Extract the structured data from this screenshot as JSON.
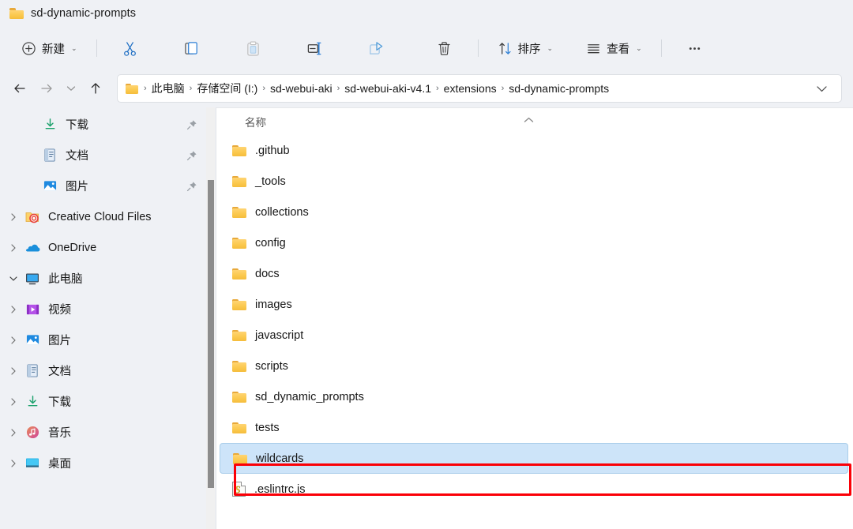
{
  "window": {
    "tab_title": "sd-dynamic-prompts",
    "tab_icon": "folder-icon"
  },
  "toolbar": {
    "new_label": "新建",
    "new_icon": "plus-circle-icon",
    "cut_icon": "scissors-icon",
    "copy_icon": "copy-icon",
    "paste_icon": "clipboard-paste-icon",
    "rename_icon": "rename-icon",
    "share_icon": "share-icon",
    "delete_icon": "trash-icon",
    "sort_label": "排序",
    "sort_icon": "sort-arrows-icon",
    "view_label": "查看",
    "view_icon": "list-lines-icon",
    "more_label": "•••",
    "more_icon": "ellipsis-icon"
  },
  "address": {
    "back_icon": "arrow-left-icon",
    "forward_icon": "arrow-right-icon",
    "recent_icon": "chevron-down-icon",
    "up_icon": "arrow-up-icon",
    "path_icon": "folder-icon",
    "crumbs": [
      "此电脑",
      "存储空间 (I:)",
      "sd-webui-aki",
      "sd-webui-aki-v4.1",
      "extensions",
      "sd-dynamic-prompts"
    ],
    "separator": "›",
    "dropdown_icon": "chevron-down-icon"
  },
  "sidebar": {
    "items": [
      {
        "label": "下载",
        "icon": "download-icon",
        "indent": 1,
        "expander": "none",
        "pinned": true
      },
      {
        "label": "文档",
        "icon": "document-icon",
        "indent": 1,
        "expander": "none",
        "pinned": true
      },
      {
        "label": "图片",
        "icon": "pictures-icon",
        "indent": 1,
        "expander": "none",
        "pinned": true
      },
      {
        "label": "Creative Cloud Files",
        "icon": "creative-cloud-icon",
        "indent": 0,
        "expander": "collapsed",
        "pinned": false
      },
      {
        "label": "OneDrive",
        "icon": "onedrive-icon",
        "indent": 0,
        "expander": "collapsed",
        "pinned": false
      },
      {
        "label": "此电脑",
        "icon": "this-pc-icon",
        "indent": 0,
        "expander": "expanded",
        "pinned": false
      },
      {
        "label": "视频",
        "icon": "videos-icon",
        "indent": 1,
        "expander": "collapsed",
        "pinned": false
      },
      {
        "label": "图片",
        "icon": "pictures-icon",
        "indent": 1,
        "expander": "collapsed",
        "pinned": false
      },
      {
        "label": "文档",
        "icon": "document-icon",
        "indent": 1,
        "expander": "collapsed",
        "pinned": false
      },
      {
        "label": "下载",
        "icon": "download-icon",
        "indent": 1,
        "expander": "collapsed",
        "pinned": false
      },
      {
        "label": "音乐",
        "icon": "music-icon",
        "indent": 1,
        "expander": "collapsed",
        "pinned": false
      },
      {
        "label": "桌面",
        "icon": "desktop-icon",
        "indent": 1,
        "expander": "collapsed",
        "pinned": false
      }
    ]
  },
  "filelist": {
    "column_header": "名称",
    "sort_indicator": "ascending",
    "rows": [
      {
        "name": ".github",
        "icon": "folder-icon",
        "selected": false
      },
      {
        "name": "_tools",
        "icon": "folder-icon",
        "selected": false
      },
      {
        "name": "collections",
        "icon": "folder-icon",
        "selected": false
      },
      {
        "name": "config",
        "icon": "folder-icon",
        "selected": false
      },
      {
        "name": "docs",
        "icon": "folder-icon",
        "selected": false
      },
      {
        "name": "images",
        "icon": "folder-icon",
        "selected": false
      },
      {
        "name": "javascript",
        "icon": "folder-icon",
        "selected": false
      },
      {
        "name": "scripts",
        "icon": "folder-icon",
        "selected": false
      },
      {
        "name": "sd_dynamic_prompts",
        "icon": "folder-icon",
        "selected": false
      },
      {
        "name": "tests",
        "icon": "folder-icon",
        "selected": false
      },
      {
        "name": "wildcards",
        "icon": "folder-icon",
        "selected": true
      },
      {
        "name": ".eslintrc.js",
        "icon": "js-file-icon",
        "selected": false
      }
    ]
  },
  "annotation": {
    "highlight_color": "#fb0007",
    "target_row": "wildcards"
  },
  "colors": {
    "chrome_background": "#eff1f5",
    "content_background": "#ffffff",
    "selection_fill": "#cde4f9",
    "selection_border": "#a9cdea",
    "folder_yellow": "#fbc94f"
  }
}
